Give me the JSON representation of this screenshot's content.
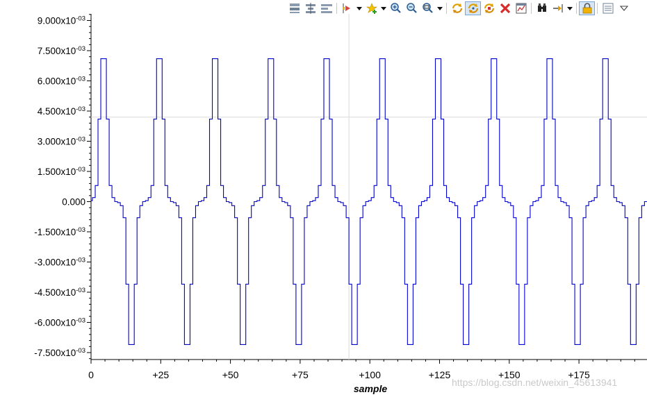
{
  "toolbar": {
    "buttons": [
      {
        "icon": "axis-stack-icon",
        "dropdown": false
      },
      {
        "icon": "axis-center-icon",
        "dropdown": false
      },
      {
        "icon": "axis-separate-icon",
        "dropdown": false
      },
      {
        "icon": "timescale-icon",
        "dropdown": true
      },
      {
        "icon": "add-marker-icon",
        "dropdown": true
      },
      {
        "icon": "zoom-in-icon",
        "dropdown": false
      },
      {
        "icon": "zoom-out-icon",
        "dropdown": false
      },
      {
        "icon": "zoom-fit-icon",
        "dropdown": true
      },
      {
        "icon": "refresh-icon",
        "dropdown": false
      },
      {
        "icon": "auto-refresh-icon",
        "dropdown": false,
        "active": true
      },
      {
        "icon": "continuous-refresh-icon",
        "dropdown": false
      },
      {
        "icon": "delete-icon",
        "dropdown": false
      },
      {
        "icon": "properties-icon",
        "dropdown": false
      },
      {
        "icon": "measure-icon",
        "dropdown": false
      },
      {
        "icon": "export-icon",
        "dropdown": true
      },
      {
        "icon": "lock-icon",
        "dropdown": false,
        "active": true
      },
      {
        "icon": "view-menu-icon",
        "dropdown": false
      },
      {
        "icon": "menu-dropdown-icon",
        "dropdown": false
      }
    ]
  },
  "chart_data": {
    "type": "line",
    "xlabel": "sample",
    "ylabel": "",
    "xlim": [
      0,
      199
    ],
    "ylim": [
      -0.0078,
      0.0093
    ],
    "x_ticks": [
      0,
      25,
      50,
      75,
      100,
      125,
      150,
      175
    ],
    "x_tick_labels": [
      "0",
      "+25",
      "+50",
      "+75",
      "+100",
      "+125",
      "+150",
      "+175"
    ],
    "y_ticks": [
      0.009,
      0.0075,
      0.006,
      0.0045,
      0.003,
      0.0015,
      0,
      -0.0015,
      -0.003,
      -0.0045,
      -0.006,
      -0.0075
    ],
    "y_tick_labels": [
      {
        "mantissa": "9.000x10",
        "exponent": "-03"
      },
      {
        "mantissa": "7.500x10",
        "exponent": "-03"
      },
      {
        "mantissa": "6.000x10",
        "exponent": "-03"
      },
      {
        "mantissa": "4.500x10",
        "exponent": "-03"
      },
      {
        "mantissa": "3.000x10",
        "exponent": "-03"
      },
      {
        "mantissa": "1.500x10",
        "exponent": "-03"
      },
      {
        "mantissa": "0.000",
        "exponent": ""
      },
      {
        "mantissa": "-1.500x10",
        "exponent": "-03"
      },
      {
        "mantissa": "-3.000x10",
        "exponent": "-03"
      },
      {
        "mantissa": "-4.500x10",
        "exponent": "-03"
      },
      {
        "mantissa": "-6.000x10",
        "exponent": "-03"
      },
      {
        "mantissa": "-7.500x10",
        "exponent": "-03"
      }
    ],
    "series": [
      {
        "color": "#0000cc",
        "period": 20,
        "cycle_values": [
          0.0,
          5e-05,
          0.0002,
          0.0008,
          0.0041,
          0.0071,
          0.0071,
          0.0041,
          0.0008,
          0.0002,
          0.0,
          -5e-05,
          -0.0002,
          -0.0008,
          -0.0041,
          -0.0071,
          -0.0071,
          -0.0041,
          -0.0008,
          -0.0002
        ],
        "phase_offset": 1,
        "n_samples": 200
      }
    ],
    "crosshair": {
      "x": 92.5,
      "y": 0.0042
    },
    "grid": false,
    "legend": "none"
  },
  "watermark": "https://blog.csdn.net/weixin_45613941"
}
